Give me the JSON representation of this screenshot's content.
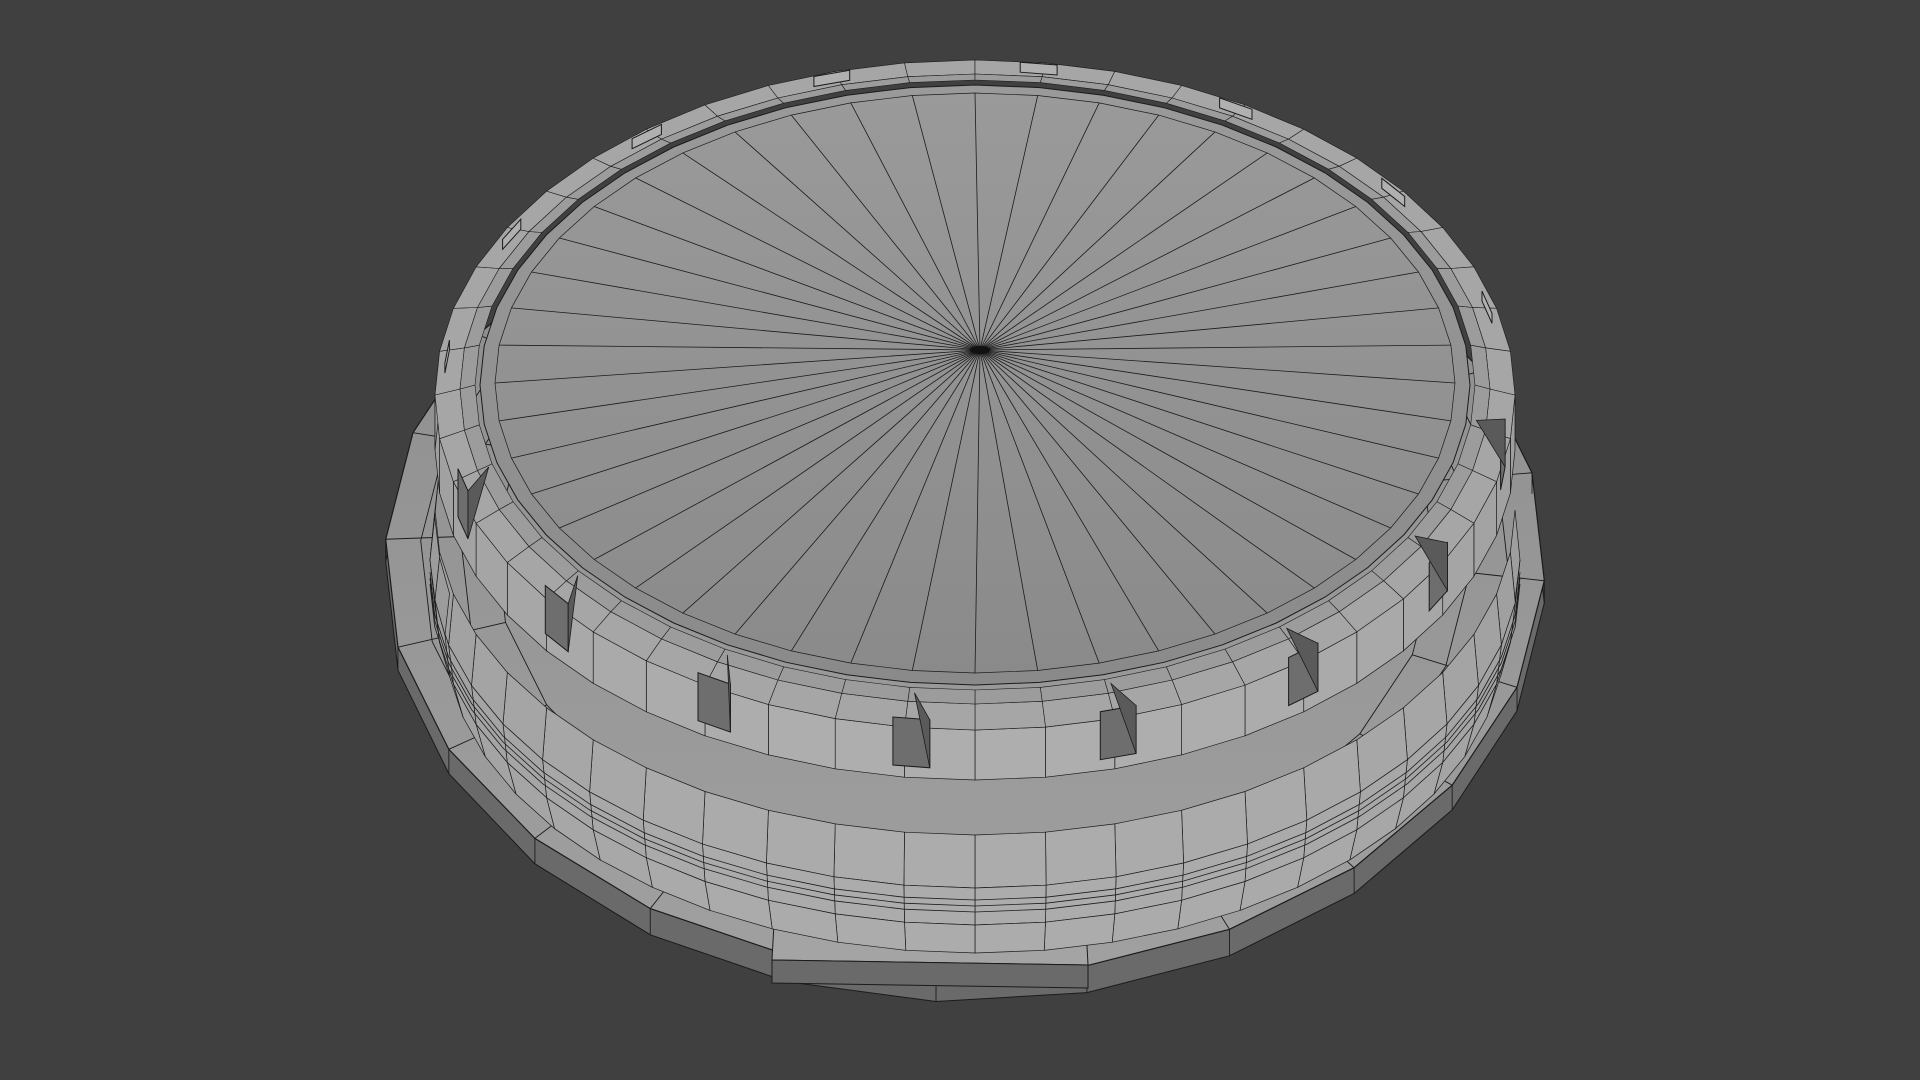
{
  "viewport": {
    "background_color": "#404040",
    "mesh_face_color": "#8e8e8e",
    "mesh_face_light": "#a4a4a4",
    "mesh_face_dark": "#6a6a6a",
    "wire_color": "#1b1b1b",
    "view_mode": "wireframe-on-shaded"
  },
  "object": {
    "type": "mesh",
    "shape": "round-lid-with-flange",
    "radial_segments": 48,
    "top_notches": 16,
    "flange_tab": true
  }
}
